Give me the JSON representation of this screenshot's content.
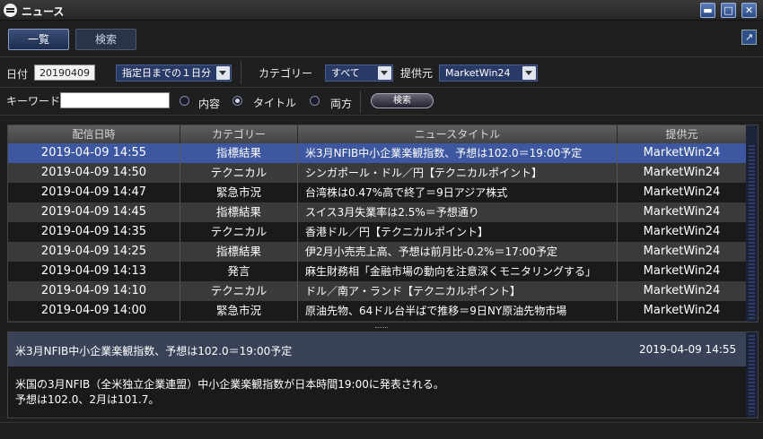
{
  "window": {
    "title": "ニュース"
  },
  "tabs": {
    "list": "一覧",
    "search": "検索"
  },
  "filters": {
    "date_label": "日付",
    "date_value": "20190409",
    "range_value": "指定日までの１日分",
    "category_label": "カテゴリー",
    "category_value": "すべて",
    "provider_label": "提供元",
    "provider_value": "MarketWin24",
    "keyword_label": "キーワード",
    "keyword_value": "",
    "radio_content": "内容",
    "radio_title": "タイトル",
    "radio_both": "両方",
    "search_button": "検索"
  },
  "table": {
    "headers": {
      "date": "配信日時",
      "category": "カテゴリー",
      "title": "ニュースタイトル",
      "provider": "提供元"
    },
    "rows": [
      {
        "date": "2019-04-09 14:55",
        "category": "指標結果",
        "title": "米3月NFIB中小企業楽観指数、予想は102.0＝19:00予定",
        "provider": "MarketWin24"
      },
      {
        "date": "2019-04-09 14:50",
        "category": "テクニカル",
        "title": "シンガポール・ドル／円【テクニカルポイント】",
        "provider": "MarketWin24"
      },
      {
        "date": "2019-04-09 14:47",
        "category": "緊急市況",
        "title": "台湾株は0.47%高で終了＝9日アジア株式",
        "provider": "MarketWin24"
      },
      {
        "date": "2019-04-09 14:45",
        "category": "指標結果",
        "title": "スイス3月失業率は2.5%＝予想通り",
        "provider": "MarketWin24"
      },
      {
        "date": "2019-04-09 14:35",
        "category": "テクニカル",
        "title": "香港ドル／円【テクニカルポイント】",
        "provider": "MarketWin24"
      },
      {
        "date": "2019-04-09 14:25",
        "category": "指標結果",
        "title": "伊2月小売売上高、予想は前月比-0.2%＝17:00予定",
        "provider": "MarketWin24"
      },
      {
        "date": "2019-04-09 14:13",
        "category": "発言",
        "title": "麻生財務相「金融市場の動向を注意深くモニタリングする」",
        "provider": "MarketWin24"
      },
      {
        "date": "2019-04-09 14:10",
        "category": "テクニカル",
        "title": "ドル／南ア・ランド【テクニカルポイント】",
        "provider": "MarketWin24"
      },
      {
        "date": "2019-04-09 14:00",
        "category": "緊急市況",
        "title": "原油先物、64ドル台半ばで推移＝9日NY原油先物市場",
        "provider": "MarketWin24"
      }
    ],
    "selected_index": 0
  },
  "detail": {
    "title": "米3月NFIB中小企業楽観指数、予想は102.0＝19:00予定",
    "time": "2019-04-09 14:55",
    "body_line1": "米国の3月NFIB（全米独立企業連盟）中小企業楽観指数が日本時間19:00に発表される。",
    "body_line2": "予想は102.0、2月は101.7。"
  },
  "colors": {
    "selected_row": "#3d57a0",
    "row_even": "#1a1a1a",
    "row_odd": "#3a3a3a",
    "accent": "#2a3a66"
  }
}
